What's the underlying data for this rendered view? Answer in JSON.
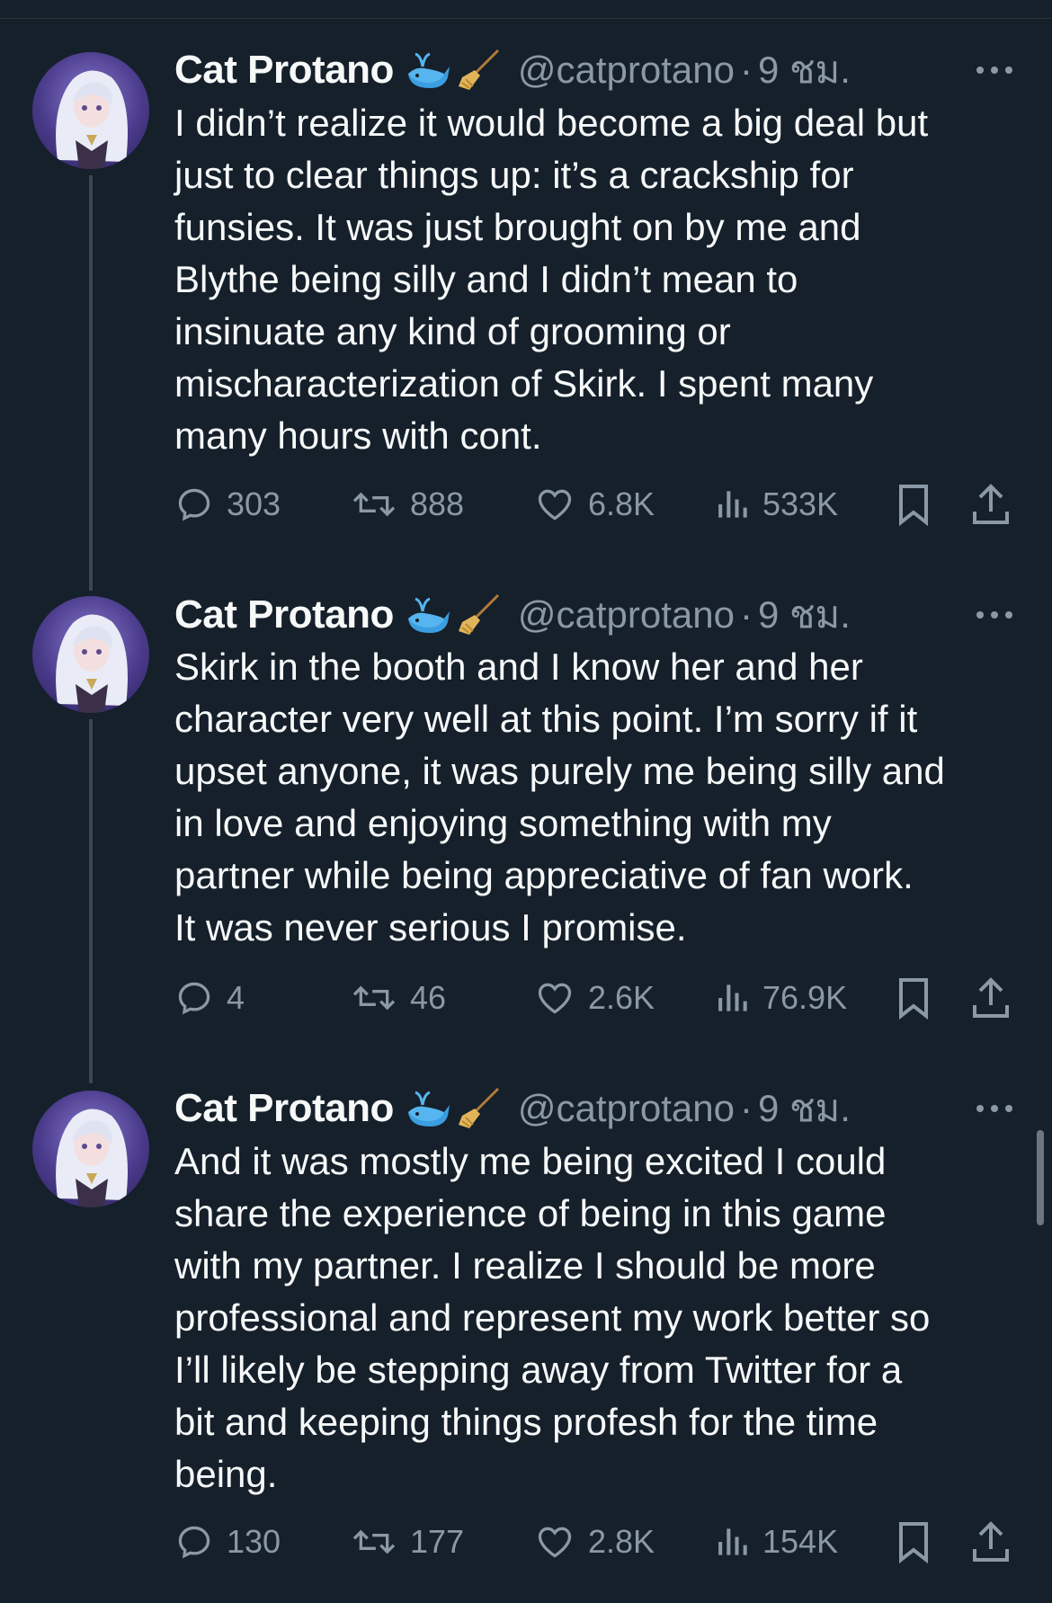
{
  "tweets": [
    {
      "name": "Cat Protano",
      "handle": "@catprotano",
      "separator": "·",
      "time": "9 ชม.",
      "lines": [
        "I didn’t realize it would become a big deal but",
        "just to clear things up: it’s a crackship for",
        "funsies.  It was just brought on by me and",
        "Blythe being silly and I didn’t mean to",
        "insinuate any kind of grooming or",
        "mischaracterization of Skirk.  I spent many",
        "many hours with cont."
      ],
      "replies": "303",
      "retweets": "888",
      "likes": "6.8K",
      "views": "533K"
    },
    {
      "name": "Cat Protano",
      "handle": "@catprotano",
      "separator": "·",
      "time": "9 ชม.",
      "lines": [
        "Skirk in the booth and I know her and her",
        "character very well at this point.  I’m sorry if it",
        "upset anyone, it was purely me being silly and",
        "in love and enjoying something with my",
        "partner while being appreciative of fan work.",
        "It was never serious I promise."
      ],
      "replies": "4",
      "retweets": "46",
      "likes": "2.6K",
      "views": "76.9K"
    },
    {
      "name": "Cat Protano",
      "handle": "@catprotano",
      "separator": "·",
      "time": "9 ชม.",
      "lines": [
        "And it was mostly me being excited I could",
        "share the experience of being in this game",
        "with my partner.  I realize I should be more",
        "professional and represent my work better so",
        "I’ll likely be stepping away from Twitter for a",
        "bit and keeping things profesh for the time",
        "being."
      ],
      "replies": "130",
      "retweets": "177",
      "likes": "2.8K",
      "views": "154K"
    }
  ],
  "icons": {
    "emoji_1": "whale-emoji-icon",
    "emoji_2": "broom-emoji-icon",
    "reply": "reply-icon",
    "retweet": "retweet-icon",
    "like": "heart-icon",
    "views": "views-icon",
    "bookmark": "bookmark-icon",
    "share": "share-icon",
    "more": "more-options-icon"
  },
  "colors": {
    "background": "#15202b",
    "text": "#f7f9f9",
    "secondary": "#8b98a5",
    "thread_line": "#3a4652"
  }
}
